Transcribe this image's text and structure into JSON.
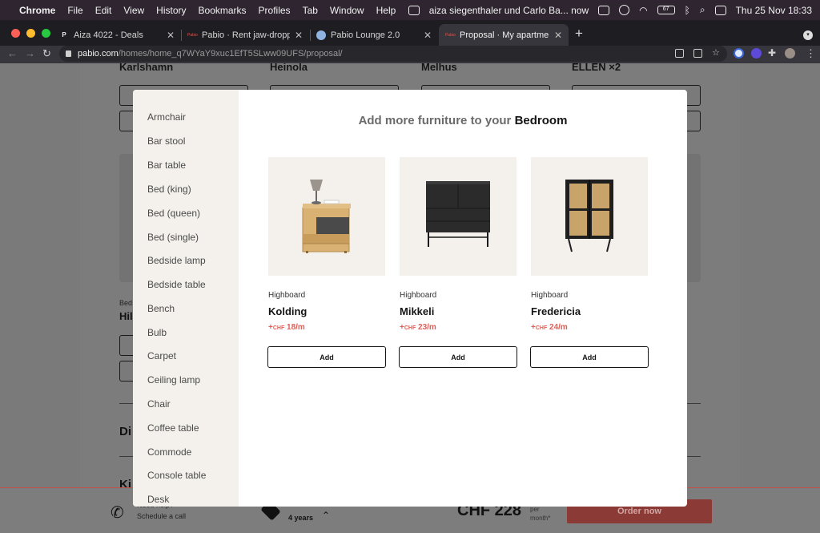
{
  "menubar": {
    "app": "Chrome",
    "items": [
      "File",
      "Edit",
      "View",
      "History",
      "Bookmarks",
      "Profiles",
      "Tab",
      "Window",
      "Help"
    ],
    "notification": "aiza siegenthaler und Carlo Ba... now",
    "battery": "67",
    "datetime": "Thu 25 Nov  18:33"
  },
  "tabs": [
    {
      "title": "Aiza 4022 - Deals",
      "favicon": "P"
    },
    {
      "title": "Pabio · Rent jaw-dropping inte",
      "favicon": "Pabio"
    },
    {
      "title": "Pabio Lounge 2.0",
      "favicon": "cloud"
    },
    {
      "title": "Proposal · My apartment · Pabi",
      "favicon": "Pabio"
    }
  ],
  "address": {
    "host": "pabio.com",
    "path": "/homes/home_q7WYaY9xuc1EfT5SLww09UFS/proposal/"
  },
  "background": {
    "names": [
      "Karlshamn",
      "Heinola",
      "Melhus",
      "ELLEN ×2"
    ],
    "section_label": "Bed",
    "section_name": "Hil",
    "section2": "Di",
    "section3": "Ki",
    "help_title": "Need help?",
    "help_sub": "Schedule a call",
    "duration": "4 years",
    "price": "CHF 228",
    "per": "per",
    "month": "month*",
    "order": "Order now"
  },
  "modal": {
    "heading_prefix": "Add more furniture to your",
    "room": "Bedroom",
    "categories": [
      "Armchair",
      "Bar stool",
      "Bar table",
      "Bed (king)",
      "Bed (queen)",
      "Bed (single)",
      "Bedside lamp",
      "Bedside table",
      "Bench",
      "Bulb",
      "Carpet",
      "Ceiling lamp",
      "Chair",
      "Coffee table",
      "Commode",
      "Console table",
      "Desk"
    ],
    "products": [
      {
        "category": "Highboard",
        "name": "Kolding",
        "price_prefix": "+",
        "currency": "CHF",
        "price": "18/m",
        "add": "Add"
      },
      {
        "category": "Highboard",
        "name": "Mikkeli",
        "price_prefix": "+",
        "currency": "CHF",
        "price": "23/m",
        "add": "Add"
      },
      {
        "category": "Highboard",
        "name": "Fredericia",
        "price_prefix": "+",
        "currency": "CHF",
        "price": "24/m",
        "add": "Add"
      }
    ]
  },
  "colors": {
    "accent_price": "#e05c55",
    "sidebar_bg": "#f4f1ec",
    "order_button": "#8c3a36"
  }
}
